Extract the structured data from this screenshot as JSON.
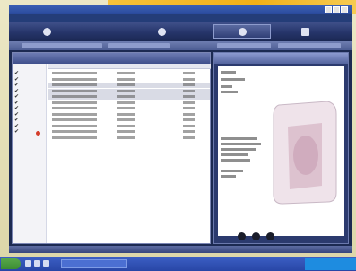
{
  "window": {
    "title": ""
  },
  "menu": {
    "items": [
      "",
      "",
      "",
      ""
    ]
  },
  "nav": {
    "items": [
      {
        "label": "",
        "icon": "home-icon"
      },
      {
        "label": "",
        "icon": "disc-icon"
      },
      {
        "label": "",
        "icon": "music-note-icon"
      },
      {
        "label": "",
        "icon": "device-icon"
      }
    ],
    "active_index": 2
  },
  "library": {
    "title": "",
    "rows": [
      {
        "title": "",
        "time": "",
        "value": "",
        "checked": true,
        "selected": false
      },
      {
        "title": "",
        "time": "",
        "value": "",
        "checked": true,
        "selected": false
      },
      {
        "title": "",
        "time": "",
        "value": "",
        "checked": true,
        "selected": true
      },
      {
        "title": "",
        "time": "",
        "value": "",
        "checked": true,
        "selected": true
      },
      {
        "title": "",
        "time": "",
        "value": "",
        "checked": true,
        "selected": true
      },
      {
        "title": "",
        "time": "",
        "value": "",
        "checked": true,
        "selected": false
      },
      {
        "title": "",
        "time": "",
        "value": "",
        "checked": true,
        "selected": false
      },
      {
        "title": "",
        "time": "",
        "value": "",
        "checked": true,
        "selected": false
      },
      {
        "title": "",
        "time": "",
        "value": "",
        "checked": true,
        "selected": false
      },
      {
        "title": "",
        "time": "",
        "value": "",
        "checked": true,
        "selected": false
      },
      {
        "title": "",
        "time": "",
        "value": "",
        "checked": true,
        "selected": false
      },
      {
        "title": "",
        "time": "",
        "value": "",
        "checked": false,
        "selected": false
      }
    ]
  },
  "details": {
    "title": ""
  },
  "taskbar": {
    "start_label": "",
    "task_label": ""
  },
  "colors": {
    "nav_bg": "#26356a",
    "window_title": "#2a4a9c",
    "accent_gold": "#f2b018",
    "row_selected": "#d9dbe5"
  }
}
